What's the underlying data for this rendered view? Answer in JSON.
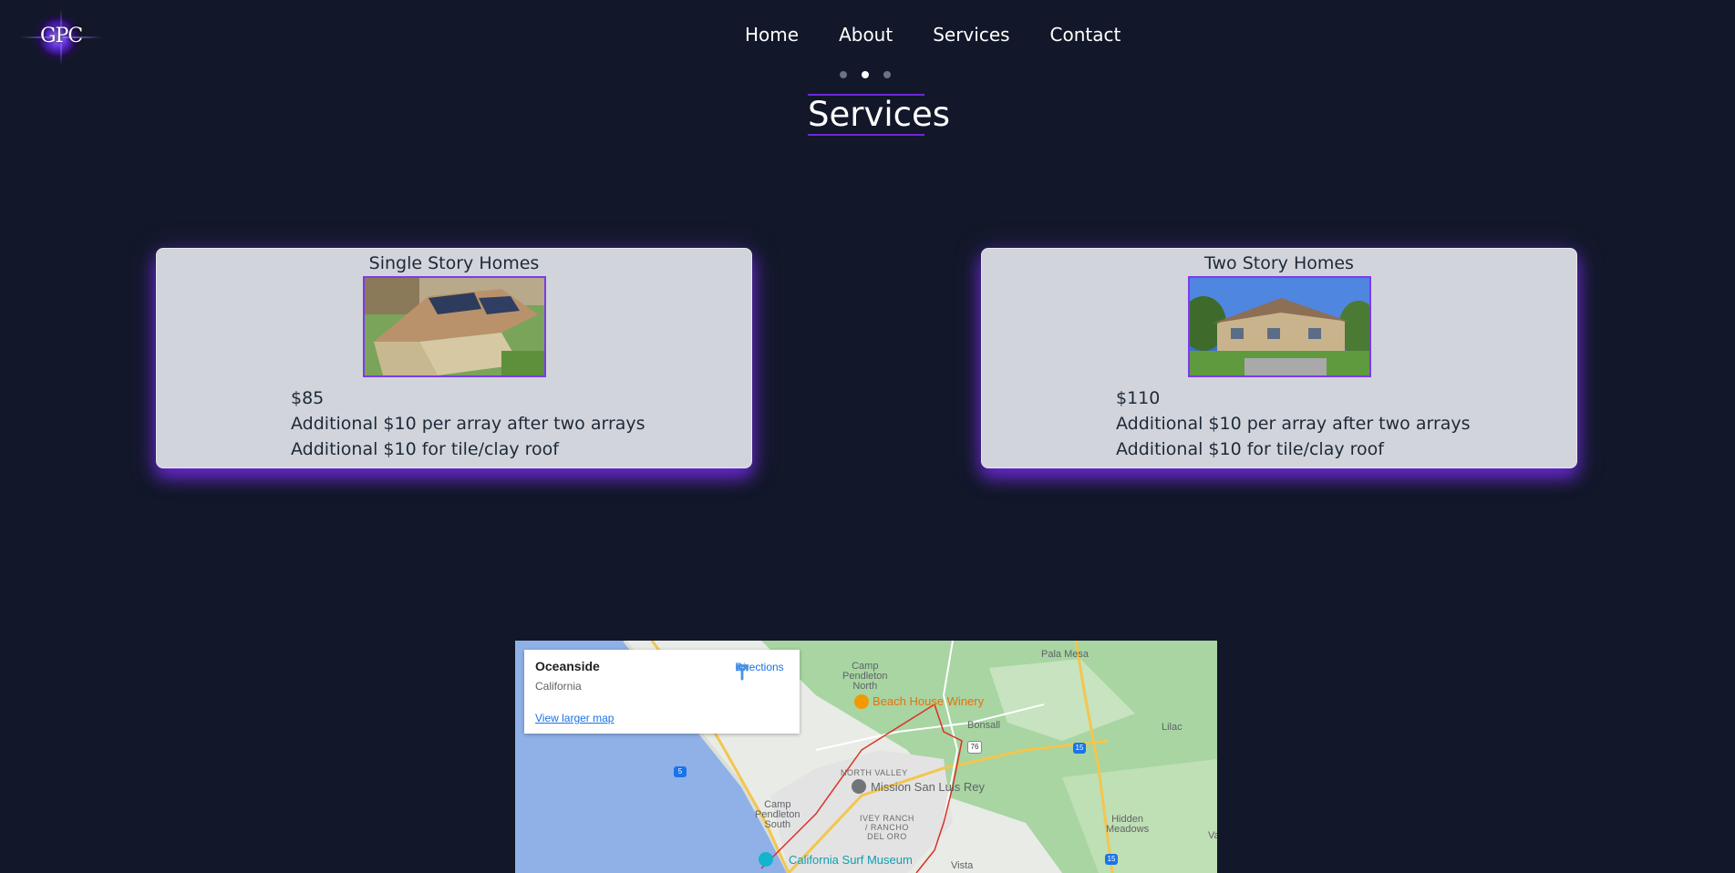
{
  "logo": {
    "text": "GPC"
  },
  "nav": {
    "items": [
      "Home",
      "About",
      "Services",
      "Contact"
    ]
  },
  "carousel": {
    "dots": 3,
    "active_index": 1
  },
  "section": {
    "title": "Services"
  },
  "cards": [
    {
      "title": "Single Story Homes",
      "price": "$85",
      "lines": [
        "Additional $10 per array after two arrays",
        "Additional $10 for tile/clay roof"
      ]
    },
    {
      "title": "Two Story Homes",
      "price": "$110",
      "lines": [
        "Additional $10 per array after two arrays",
        "Additional $10 for tile/clay roof"
      ]
    }
  ],
  "map": {
    "place": "Oceanside",
    "region": "California",
    "directions_label": "Directions",
    "view_larger_label": "View larger map",
    "labels": {
      "camp_pendleton_north": [
        "Camp",
        "Pendleton",
        "North"
      ],
      "camp_pendleton_south": [
        "Camp",
        "Pendleton",
        "South"
      ],
      "pala_mesa": "Pala Mesa",
      "beach_house_winery": "Beach House Winery",
      "bonsall": "Bonsall",
      "lilac": "Lilac",
      "north_valley": "NORTH VALLEY",
      "mission_san_luis_rey": "Mission San Luis Rey",
      "ivey_ranch": [
        "IVEY RANCH",
        "/ RANCHO",
        "DEL ORO"
      ],
      "hidden_meadows": [
        "Hidden",
        "Meadows"
      ],
      "california_surf_museum": "California Surf Museum",
      "vista": "Vista",
      "va": "Va"
    },
    "shields": [
      "5",
      "76",
      "15",
      "15"
    ]
  }
}
